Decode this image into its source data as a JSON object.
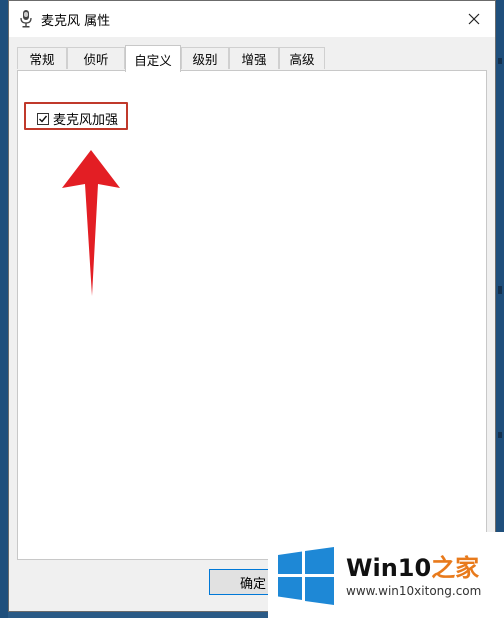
{
  "window": {
    "title": "麦克风 属性",
    "close_icon": "close-icon"
  },
  "tabs": [
    {
      "label": "常规",
      "active": false
    },
    {
      "label": "侦听",
      "active": false
    },
    {
      "label": "自定义",
      "active": true
    },
    {
      "label": "级别",
      "active": false
    },
    {
      "label": "增强",
      "active": false
    },
    {
      "label": "高级",
      "active": false
    }
  ],
  "custom": {
    "checkbox_label": "麦克风加强",
    "checked": true
  },
  "buttons": {
    "ok_label": "确定"
  },
  "watermark": {
    "brand_latin": "Win10",
    "brand_cn": "之家",
    "url": "www.win10xitong.com"
  },
  "colors": {
    "annotation_red": "#e31e24",
    "highlight_border": "#c0392b",
    "brand_blue": "#1e88d6",
    "brand_orange": "#e87a1c"
  }
}
